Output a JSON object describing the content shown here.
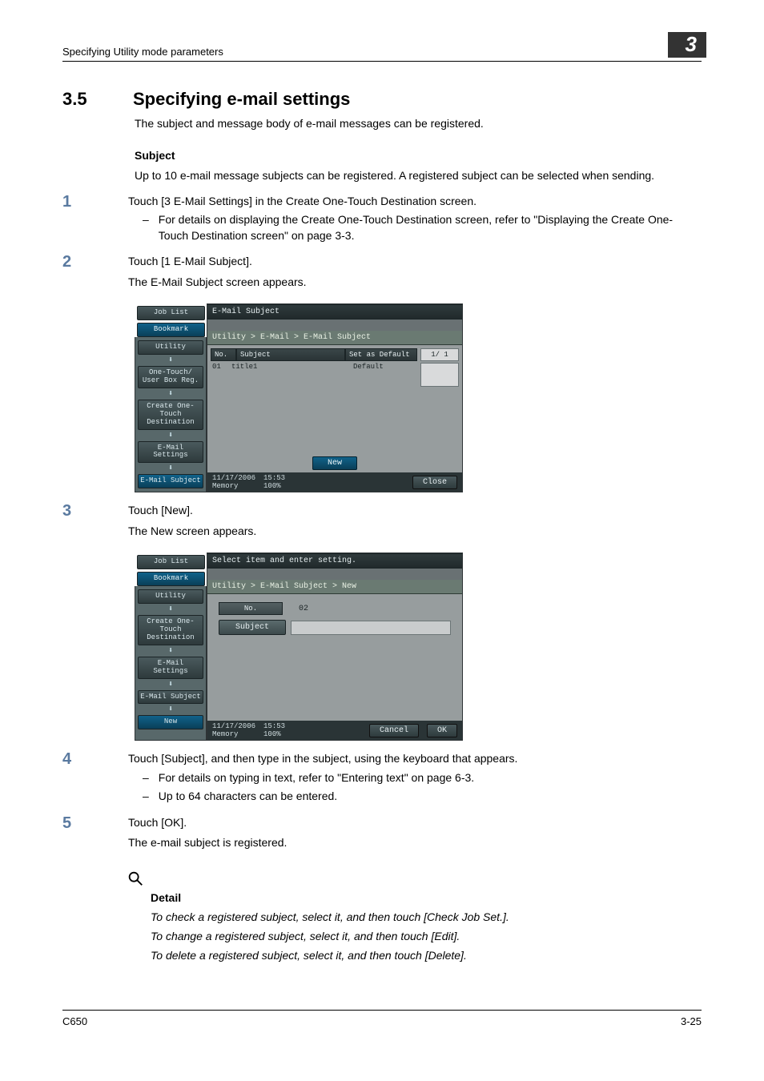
{
  "header": {
    "left": "Specifying Utility mode parameters",
    "right": "3"
  },
  "section": {
    "num": "3.5",
    "title": "Specifying e-mail settings"
  },
  "intro": "The subject and message body of e-mail messages can be registered.",
  "sub": {
    "heading": "Subject",
    "text": "Up to 10 e-mail message subjects can be registered. A registered subject can be selected when sending."
  },
  "steps": {
    "s1": {
      "num": "1",
      "text": "Touch [3 E-Mail Settings] in the Create One-Touch Destination screen.",
      "b1": "For details on displaying the Create One-Touch Destination screen, refer to \"Displaying the Create One-Touch Destination screen\" on page 3-3."
    },
    "s2": {
      "num": "2",
      "text": "Touch [1 E-Mail Subject].",
      "after": "The E-Mail Subject screen appears."
    },
    "s3": {
      "num": "3",
      "text": "Touch [New].",
      "after": "The New screen appears."
    },
    "s4": {
      "num": "4",
      "text": "Touch [Subject], and then type in the subject, using the keyboard that appears.",
      "b1": "For details on typing in text, refer to \"Entering text\" on page 6-3.",
      "b2": "Up to 64 characters can be entered."
    },
    "s5": {
      "num": "5",
      "text": "Touch [OK].",
      "after": "The e-mail subject is registered."
    }
  },
  "detail": {
    "head": "Detail",
    "l1": "To check a registered subject, select it, and then touch [Check Job Set.].",
    "l2": "To change a registered subject, select it, and then touch [Edit].",
    "l3": "To delete a registered subject, select it, and then touch [Delete]."
  },
  "footer": {
    "left": "C650",
    "right": "3-25"
  },
  "ui1": {
    "tabs": {
      "job": "Job List",
      "book": "Bookmark"
    },
    "side": {
      "utility": "Utility",
      "onetouch": "One-Touch/\nUser Box Reg.",
      "create": "Create One-Touch\nDestination",
      "email": "E-Mail Settings",
      "subject": "E-Mail Subject"
    },
    "title": "E-Mail Subject",
    "crumb": "Utility > E-Mail > E-Mail Subject",
    "cols": {
      "no": "No.",
      "subject": "Subject",
      "default": "Set as Default"
    },
    "row": {
      "no": "01",
      "subject": "title1",
      "default": "Default"
    },
    "page": "1/  1",
    "new": "New",
    "status": {
      "date": "11/17/2006",
      "time": "15:53",
      "meml": "Memory",
      "memv": "100%"
    },
    "close": "Close"
  },
  "ui2": {
    "tabs": {
      "job": "Job List",
      "book": "Bookmark"
    },
    "side": {
      "utility": "Utility",
      "create": "Create One-Touch\nDestination",
      "email": "E-Mail Settings",
      "subject": "E-Mail Subject",
      "new": "New"
    },
    "title": "Select item and enter setting.",
    "crumb": "Utility > E-Mail Subject > New",
    "no_label": "No.",
    "no_val": "02",
    "subject_btn": "Subject",
    "status": {
      "date": "11/17/2006",
      "time": "15:53",
      "meml": "Memory",
      "memv": "100%"
    },
    "cancel": "Cancel",
    "ok": "OK"
  }
}
